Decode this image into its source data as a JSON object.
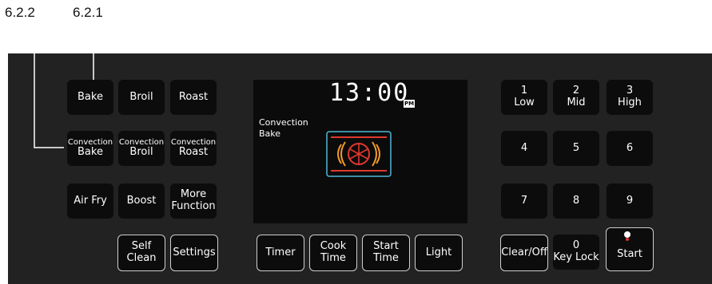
{
  "callouts": {
    "left": "6.2.2",
    "right": "6.2.1"
  },
  "modes": {
    "bake": "Bake",
    "broil": "Broil",
    "roast": "Roast",
    "conv_prefix": "Convection",
    "conv_bake": "Bake",
    "conv_broil": "Broil",
    "conv_roast": "Roast",
    "air_fry": "Air Fry",
    "boost": "Boost",
    "more_l1": "More",
    "more_l2": "Function",
    "self_l1": "Self",
    "self_l2": "Clean",
    "settings": "Settings"
  },
  "display": {
    "time": "13:00",
    "ampm": "PM",
    "mode_l1": "Convection",
    "mode_l2": "Bake",
    "colors": {
      "frame": "#4fb6d8",
      "heat": "#e0382e",
      "fan": "#f09a2a"
    }
  },
  "controls": {
    "timer": "Timer",
    "cook_l1": "Cook",
    "cook_l2": "Time",
    "start_time_l1": "Start",
    "start_time_l2": "Time",
    "light": "Light"
  },
  "keypad": {
    "k1": "1",
    "k1s": "Low",
    "k2": "2",
    "k2s": "Mid",
    "k3": "3",
    "k3s": "High",
    "k4": "4",
    "k5": "5",
    "k6": "6",
    "k7": "7",
    "k8": "8",
    "k9": "9",
    "clear": "Clear/Off",
    "k0": "0",
    "k0s": "Key Lock",
    "start": "Start"
  }
}
